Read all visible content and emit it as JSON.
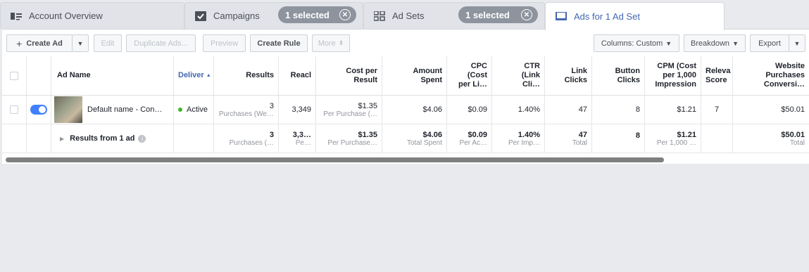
{
  "tabs": {
    "account": "Account Overview",
    "campaigns": "Campaigns",
    "campaigns_pill": "1 selected",
    "adsets": "Ad Sets",
    "adsets_pill": "1 selected",
    "ads": "Ads for 1 Ad Set"
  },
  "toolbar": {
    "create_ad": "Create Ad",
    "edit": "Edit",
    "duplicate": "Duplicate Ads...",
    "preview": "Preview",
    "create_rule": "Create Rule",
    "more": "More",
    "columns": "Columns: Custom",
    "breakdown": "Breakdown",
    "export": "Export"
  },
  "headers": {
    "ad_name": "Ad Name",
    "delivery": "Deliver",
    "results": "Results",
    "reach": "Reacl",
    "cost_per_result": [
      "Cost per",
      "Result"
    ],
    "amount_spent": [
      "Amount",
      "Spent"
    ],
    "cpc": [
      "CPC",
      "(Cost",
      "per Li…"
    ],
    "ctr": [
      "CTR",
      "(Link",
      "Cli…"
    ],
    "link_clicks": [
      "Link",
      "Clicks"
    ],
    "button_clicks": [
      "Button",
      "Clicks"
    ],
    "cpm": [
      "CPM (Cost",
      "per 1,000",
      "Impression"
    ],
    "relevance": [
      "Releva",
      "Score"
    ],
    "website": [
      "Website",
      "Purchases",
      "Conversi…"
    ]
  },
  "ad_row": {
    "name": "Default name - Con…",
    "delivery": "Active",
    "results": "3",
    "results_sub": "Purchases (We…",
    "reach": "3,349",
    "cost_per_result": "$1.35",
    "cost_per_result_sub": "Per Purchase (…",
    "amount_spent": "$4.06",
    "cpc": "$0.09",
    "ctr": "1.40%",
    "link_clicks": "47",
    "button_clicks": "8",
    "cpm": "$1.21",
    "relevance": "7",
    "website": "$50.01"
  },
  "total_row": {
    "label": "Results from 1 ad",
    "results": "3",
    "results_sub": "Purchases (…",
    "reach": "3,3…",
    "reach_sub": "Pe…",
    "cost_per_result": "$1.35",
    "cost_per_result_sub": "Per Purchase…",
    "amount_spent": "$4.06",
    "amount_spent_sub": "Total Spent",
    "cpc": "$0.09",
    "cpc_sub": "Per Ac…",
    "ctr": "1.40%",
    "ctr_sub": "Per Imp…",
    "link_clicks": "47",
    "link_clicks_sub": "Total",
    "button_clicks": "8",
    "cpm": "$1.21",
    "cpm_sub": "Per 1,000 …",
    "website": "$50.01",
    "website_sub": "Total"
  },
  "colors": {
    "accent": "#4267b2",
    "toggle": "#4080ff",
    "active_dot": "#42b72a"
  }
}
